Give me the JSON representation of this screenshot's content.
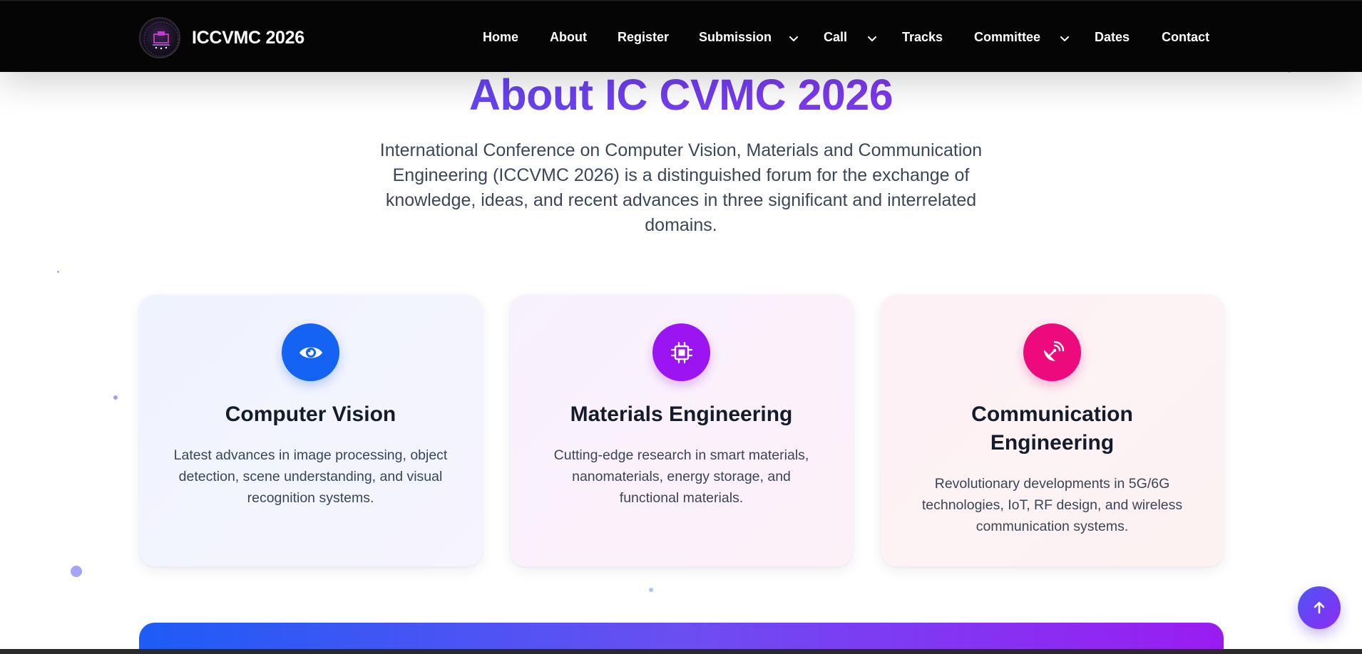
{
  "brand": {
    "name": "ICCVMC 2026",
    "logo_icon": "conference-logo-icon"
  },
  "nav": {
    "items": [
      {
        "label": "Home"
      },
      {
        "label": "About"
      },
      {
        "label": "Register"
      },
      {
        "label": "Submission",
        "dropdown": true
      },
      {
        "label": "Call",
        "dropdown": true
      },
      {
        "label": "Tracks"
      },
      {
        "label": "Committee",
        "dropdown": true
      },
      {
        "label": "Dates"
      },
      {
        "label": "Contact"
      }
    ]
  },
  "about": {
    "title": "About IC CVMC 2026",
    "intro": "International Conference on Computer Vision, Materials and Communication Engineering (ICCVMC 2026) is a distinguished forum for the exchange of knowledge, ideas, and recent advances in three significant and interrelated domains."
  },
  "cards": [
    {
      "icon": "eye-icon",
      "title": "Computer Vision",
      "text": "Latest advances in image processing, object detection, scene understanding, and visual recognition systems."
    },
    {
      "icon": "microchip-icon",
      "title": "Materials Engineering",
      "text": "Cutting-edge research in smart materials, nanomaterials, energy storage, and functional materials."
    },
    {
      "icon": "satellite-dish-icon",
      "title": "Communication Engineering",
      "text": "Revolutionary developments in 5G/6G technologies, IoT, RF design, and wireless communication systems."
    }
  ],
  "scroll_top": {
    "icon": "arrow-up-icon"
  },
  "colors": {
    "accent_blue": "#1463f3",
    "accent_purple": "#9b14f2",
    "accent_pink": "#ec0a7c",
    "title_gradient": "#6d3cf0",
    "navbar": "#050505"
  }
}
